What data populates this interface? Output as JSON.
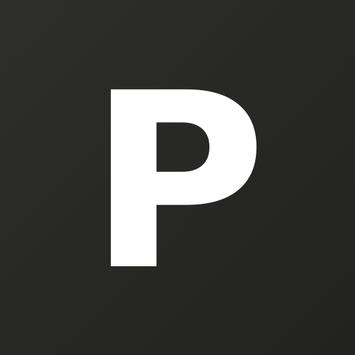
{
  "icon": {
    "letter": "P",
    "background_color": "#282826",
    "letter_color": "#ffffff"
  }
}
